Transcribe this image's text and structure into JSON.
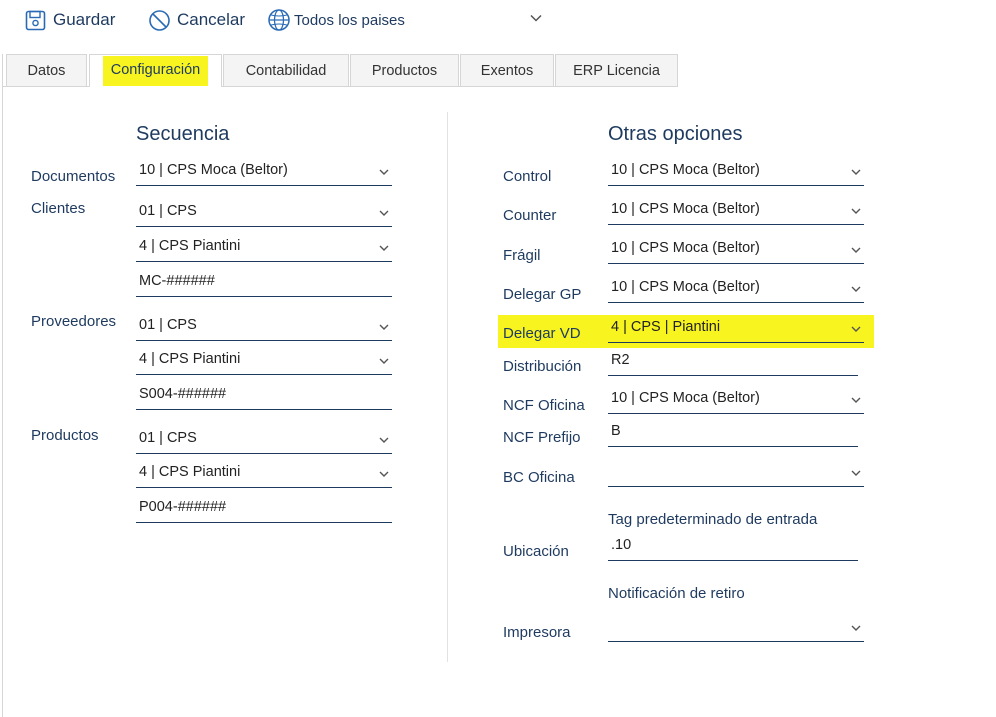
{
  "toolbar": {
    "save_label": "Guardar",
    "cancel_label": "Cancelar",
    "country_label": "Todos los paises"
  },
  "tabs": [
    {
      "label": "Datos"
    },
    {
      "label": "Configuración",
      "active": true
    },
    {
      "label": "Contabilidad"
    },
    {
      "label": "Productos"
    },
    {
      "label": "Exentos"
    },
    {
      "label": "ERP Licencia"
    }
  ],
  "secuencia": {
    "title": "Secuencia",
    "documentos": {
      "label": "Documentos",
      "value": "10 | CPS Moca (Beltor)"
    },
    "clientes": {
      "label": "Clientes",
      "select1": "01 | CPS",
      "select2": "4 | CPS Piantini",
      "mask": "MC-######"
    },
    "proveedores": {
      "label": "Proveedores",
      "select1": "01 | CPS",
      "select2": "4 | CPS Piantini",
      "mask": "S004-######"
    },
    "productos": {
      "label": "Productos",
      "select1": "01 | CPS",
      "select2": "4 | CPS Piantini",
      "mask": "P004-######"
    }
  },
  "otras": {
    "title": "Otras opciones",
    "control": {
      "label": "Control",
      "value": "10 | CPS Moca (Beltor)"
    },
    "counter": {
      "label": "Counter",
      "value": "10 | CPS Moca (Beltor)"
    },
    "fragil": {
      "label": "Frágil",
      "value": "10 | CPS Moca (Beltor)"
    },
    "delegar_gp": {
      "label": "Delegar GP",
      "value": "10 | CPS Moca (Beltor)"
    },
    "delegar_vd": {
      "label": "Delegar VD",
      "value": "4 | CPS | Piantini"
    },
    "distribucion": {
      "label": "Distribución",
      "value": "R2"
    },
    "ncf_oficina": {
      "label": "NCF Oficina",
      "value": "10 | CPS Moca (Beltor)"
    },
    "ncf_prefijo": {
      "label": "NCF Prefijo",
      "value": "B"
    },
    "bc_oficina": {
      "label": "BC Oficina",
      "value": ""
    },
    "tag_predeterminado": {
      "label": "Tag predeterminado de entrada"
    },
    "ubicacion": {
      "label": "Ubicación",
      "value": ".10"
    },
    "notificacion_retiro": {
      "label": "Notificación de retiro"
    },
    "impresora": {
      "label": "Impresora",
      "value": ""
    }
  },
  "colors": {
    "highlight": "#f7f420",
    "text": "#1e3a5f",
    "underline": "#1e3a5f"
  },
  "icons": {
    "save": "save-icon",
    "cancel": "cancel-icon",
    "country": "globe-icon",
    "dropdown": "chevron-down-icon"
  }
}
